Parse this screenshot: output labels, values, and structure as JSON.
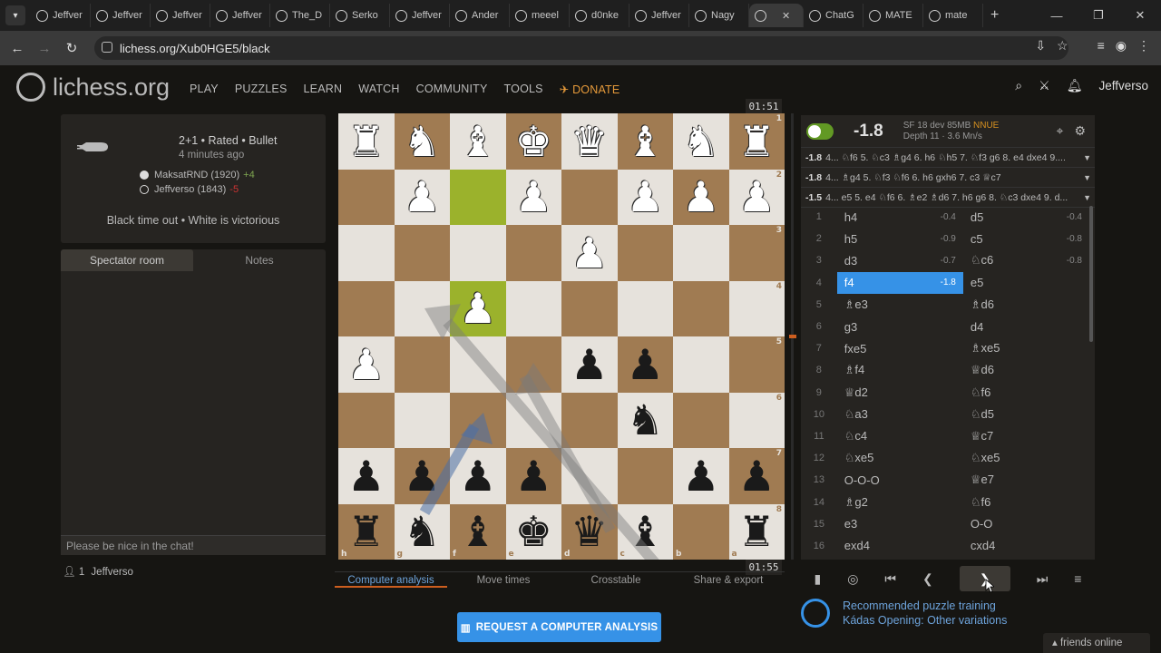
{
  "browser": {
    "tabs": [
      {
        "label": "Jeffver"
      },
      {
        "label": "Jeffver"
      },
      {
        "label": "Jeffver"
      },
      {
        "label": "Jeffver"
      },
      {
        "label": "The_D"
      },
      {
        "label": "Serko"
      },
      {
        "label": "Jeffver"
      },
      {
        "label": "Ander"
      },
      {
        "label": "meeel"
      },
      {
        "label": "d0nke"
      },
      {
        "label": "Jeffver"
      },
      {
        "label": "Nagy"
      },
      {
        "label": ""
      },
      {
        "label": "ChatG"
      },
      {
        "label": "MATE"
      },
      {
        "label": "mate"
      }
    ],
    "url": "lichess.org/Xub0HGE5/black"
  },
  "header": {
    "logo_text": "lichess.org",
    "nav": [
      "PLAY",
      "PUZZLES",
      "LEARN",
      "WATCH",
      "COMMUNITY",
      "TOOLS"
    ],
    "donate": "DONATE",
    "username": "Jeffverso"
  },
  "game": {
    "title": "2+1 • Rated • Bullet",
    "time_ago": "4 minutes ago",
    "white_player": "MaksatRND (1920)",
    "white_diff": "+4",
    "black_player": "Jeffverso (1843)",
    "black_diff": "-5",
    "result": "Black time out • White is victorious"
  },
  "chat": {
    "tab_spectator": "Spectator room",
    "tab_notes": "Notes",
    "placeholder": "Please be nice in the chat!"
  },
  "watchers": {
    "count": "1",
    "name": "Jeffverso"
  },
  "clocks": {
    "top": "01:51",
    "bottom": "01:55"
  },
  "board": {
    "rows": [
      [
        "wR",
        "wN",
        "wB",
        "wK",
        "wQ",
        "wB",
        "wN",
        "wR"
      ],
      [
        "",
        "wP",
        "",
        "wP",
        "",
        "wP",
        "wP",
        "wP"
      ],
      [
        "",
        "",
        "",
        "",
        "wP",
        "",
        "",
        ""
      ],
      [
        "",
        "",
        "wP",
        "",
        "",
        "",
        "",
        ""
      ],
      [
        "wP",
        "",
        "",
        "",
        "bP",
        "bP",
        "",
        ""
      ],
      [
        "",
        "",
        "",
        "",
        "",
        "bN",
        "",
        ""
      ],
      [
        "bP",
        "bP",
        "bP",
        "bP",
        "",
        "",
        "bP",
        "bP"
      ],
      [
        "bR",
        "bN",
        "bB",
        "bK",
        "bQ",
        "bB",
        "",
        "bR"
      ]
    ],
    "highlight": [
      [
        1,
        2
      ],
      [
        3,
        2
      ]
    ],
    "rank_labels": [
      "1",
      "2",
      "3",
      "4",
      "5",
      "6",
      "7",
      "8"
    ],
    "file_labels": [
      "h",
      "g",
      "f",
      "e",
      "d",
      "c",
      "b",
      "a"
    ]
  },
  "under_board": {
    "tabs": [
      "Computer analysis",
      "Move times",
      "Crosstable",
      "Share & export"
    ],
    "request_btn": "REQUEST A COMPUTER ANALYSIS"
  },
  "ceval": {
    "eval": "-1.8",
    "engine": "SF 18 dev 85MB",
    "nnue": "NNUE",
    "depth": "Depth 11 · 3.6 Mn/s",
    "pvs": [
      {
        "score": "-1.8",
        "line": "4... ♘f6 5. ♘c3 ♗g4 6. h6 ♘h5 7. ♘f3 g6 8. e4 dxe4 9...."
      },
      {
        "score": "-1.8",
        "line": "4... ♗g4 5. ♘f3 ♘f6 6. h6 gxh6 7. c3 ♕c7"
      },
      {
        "score": "-1.5",
        "line": "4... e5 5. e4 ♘f6 6. ♗e2 ♗d6 7. h6 g6 8. ♘c3 dxe4 9. d..."
      }
    ],
    "toggle_on": true
  },
  "moves": [
    {
      "n": "1",
      "w": "h4",
      "ws": "-0.4",
      "b": "d5",
      "bs": "-0.4"
    },
    {
      "n": "2",
      "w": "h5",
      "ws": "-0.9",
      "b": "c5",
      "bs": "-0.8"
    },
    {
      "n": "3",
      "w": "d3",
      "ws": "-0.7",
      "b": "♘c6",
      "bs": "-0.8"
    },
    {
      "n": "4",
      "w": "f4",
      "ws": "-1.8",
      "b": "e5",
      "bs": ""
    },
    {
      "n": "5",
      "w": "♗e3",
      "ws": "",
      "b": "♗d6",
      "bs": ""
    },
    {
      "n": "6",
      "w": "g3",
      "ws": "",
      "b": "d4",
      "bs": ""
    },
    {
      "n": "7",
      "w": "fxe5",
      "ws": "",
      "b": "♗xe5",
      "bs": ""
    },
    {
      "n": "8",
      "w": "♗f4",
      "ws": "",
      "b": "♕d6",
      "bs": ""
    },
    {
      "n": "9",
      "w": "♕d2",
      "ws": "",
      "b": "♘f6",
      "bs": ""
    },
    {
      "n": "10",
      "w": "♘a3",
      "ws": "",
      "b": "♘d5",
      "bs": ""
    },
    {
      "n": "11",
      "w": "♘c4",
      "ws": "",
      "b": "♕c7",
      "bs": ""
    },
    {
      "n": "12",
      "w": "♘xe5",
      "ws": "",
      "b": "♘xe5",
      "bs": ""
    },
    {
      "n": "13",
      "w": "O-O-O",
      "ws": "",
      "b": "♕e7",
      "bs": ""
    },
    {
      "n": "14",
      "w": "♗g2",
      "ws": "",
      "b": "♘f6",
      "bs": ""
    },
    {
      "n": "15",
      "w": "e3",
      "ws": "",
      "b": "O-O",
      "bs": ""
    },
    {
      "n": "16",
      "w": "exd4",
      "ws": "",
      "b": "cxd4",
      "bs": ""
    }
  ],
  "selected_move": 3,
  "puzzle": {
    "line1": "Recommended puzzle training",
    "line2": "Kádas Opening: Other variations"
  },
  "friends": "friends online",
  "colors": {
    "accent": "#3692e7",
    "donate": "#e69a3a",
    "highlight": "#9bb22c"
  }
}
